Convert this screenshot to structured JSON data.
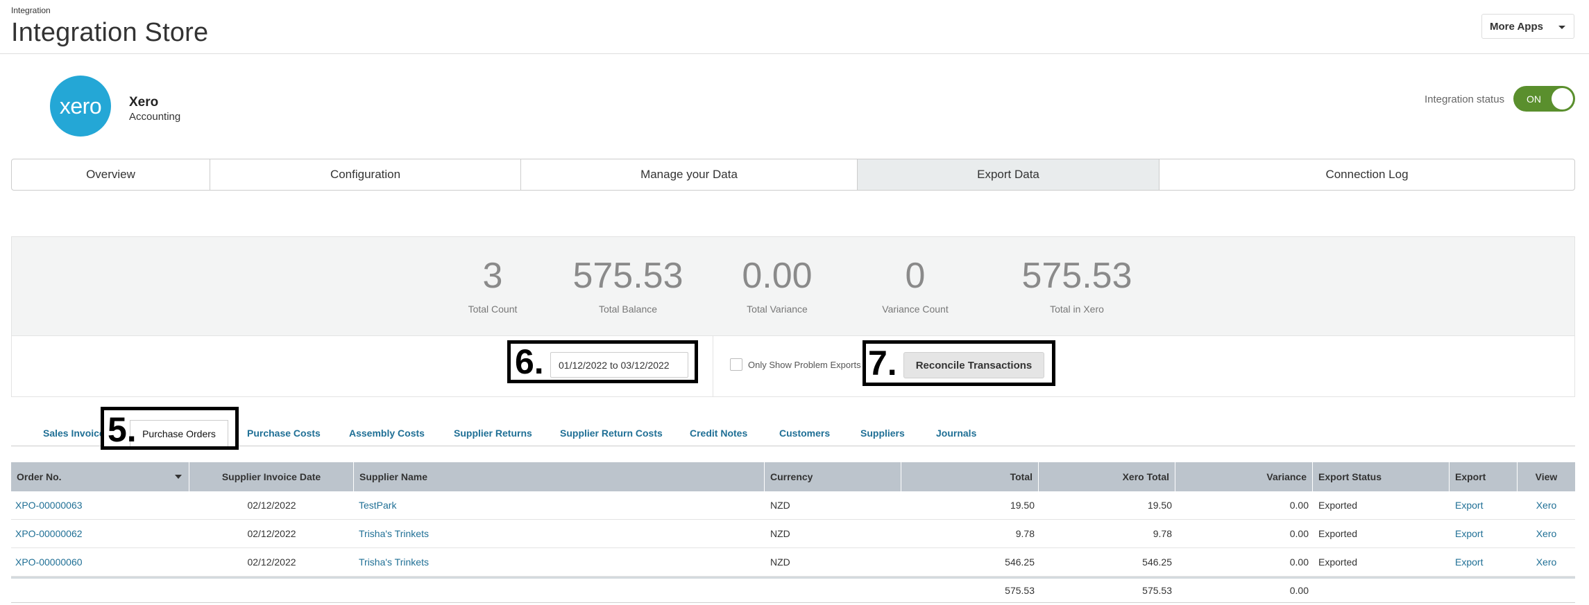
{
  "header": {
    "breadcrumb": "Integration",
    "title": "Integration Store",
    "more_apps_label": "More Apps"
  },
  "app": {
    "logo_text": "xero",
    "name": "Xero",
    "category": "Accounting",
    "status_label": "Integration status",
    "status_value": "ON"
  },
  "tabs": [
    {
      "label": "Overview"
    },
    {
      "label": "Configuration"
    },
    {
      "label": "Manage your Data"
    },
    {
      "label": "Export Data"
    },
    {
      "label": "Connection Log"
    }
  ],
  "active_tab": "Export Data",
  "summary": [
    {
      "value": "3",
      "label": "Total Count"
    },
    {
      "value": "575.53",
      "label": "Total Balance"
    },
    {
      "value": "0.00",
      "label": "Total Variance"
    },
    {
      "value": "0",
      "label": "Variance Count"
    },
    {
      "value": "575.53",
      "label": "Total in Xero"
    }
  ],
  "filters": {
    "date_range": "01/12/2022 to 03/12/2022",
    "problem_checkbox_label": "Only Show Problem Exports",
    "problem_checkbox_checked": false,
    "reconcile_label": "Reconcile Transactions"
  },
  "annotations": {
    "a5": "5.",
    "a6": "6.",
    "a7": "7."
  },
  "subtabs": [
    {
      "label": "Sales Invoice"
    },
    {
      "label": "Purchase Orders"
    },
    {
      "label": "Purchase Costs"
    },
    {
      "label": "Assembly Costs"
    },
    {
      "label": "Supplier Returns"
    },
    {
      "label": "Supplier Return Costs"
    },
    {
      "label": "Credit Notes"
    },
    {
      "label": "Customers"
    },
    {
      "label": "Suppliers"
    },
    {
      "label": "Journals"
    }
  ],
  "table": {
    "columns": [
      "Order No.",
      "Supplier Invoice Date",
      "Supplier Name",
      "Currency",
      "Total",
      "Xero Total",
      "Variance",
      "Export Status",
      "Export",
      "View"
    ],
    "rows": [
      {
        "order_no": "XPO-00000063",
        "date": "02/12/2022",
        "supplier": "TestPark",
        "currency": "NZD",
        "total": "19.50",
        "xero_total": "19.50",
        "variance": "0.00",
        "status": "Exported",
        "export": "Export",
        "view": "Xero"
      },
      {
        "order_no": "XPO-00000062",
        "date": "02/12/2022",
        "supplier": "Trisha's Trinkets",
        "currency": "NZD",
        "total": "9.78",
        "xero_total": "9.78",
        "variance": "0.00",
        "status": "Exported",
        "export": "Export",
        "view": "Xero"
      },
      {
        "order_no": "XPO-00000060",
        "date": "02/12/2022",
        "supplier": "Trisha's Trinkets",
        "currency": "NZD",
        "total": "546.25",
        "xero_total": "546.25",
        "variance": "0.00",
        "status": "Exported",
        "export": "Export",
        "view": "Xero"
      }
    ],
    "totals": {
      "total": "575.53",
      "xero_total": "575.53",
      "variance": "0.00"
    }
  }
}
